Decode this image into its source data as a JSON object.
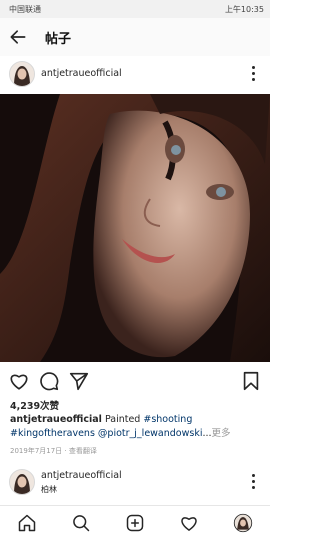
{
  "status_bar": {
    "carrier": "中国联通",
    "time": "上午10:35"
  },
  "app_bar": {
    "title": "帖子"
  },
  "post": {
    "username": "antjetraueofficial",
    "likes": "4,239次赞",
    "caption": {
      "username": "antjetraueofficial",
      "text": " Painted ",
      "tag1": "#shooting",
      "tag2": "#kingoftheravens",
      "mention": " @piotr_j_lewandowski",
      "ellipsis": "...",
      "more": "更多"
    },
    "date": "2019年7月17日 · 查看翻译"
  },
  "next_post": {
    "username": "antjetraueofficial",
    "location": "柏林"
  },
  "icons": {
    "back": "arrow-left-icon",
    "more": "more-vertical-icon",
    "like": "heart-icon",
    "comment": "comment-bubble-icon",
    "share": "send-icon",
    "save": "bookmark-icon",
    "home": "home-icon",
    "search": "search-icon",
    "add": "add-post-icon",
    "activity": "heart-icon",
    "profile": "profile-avatar-icon"
  }
}
